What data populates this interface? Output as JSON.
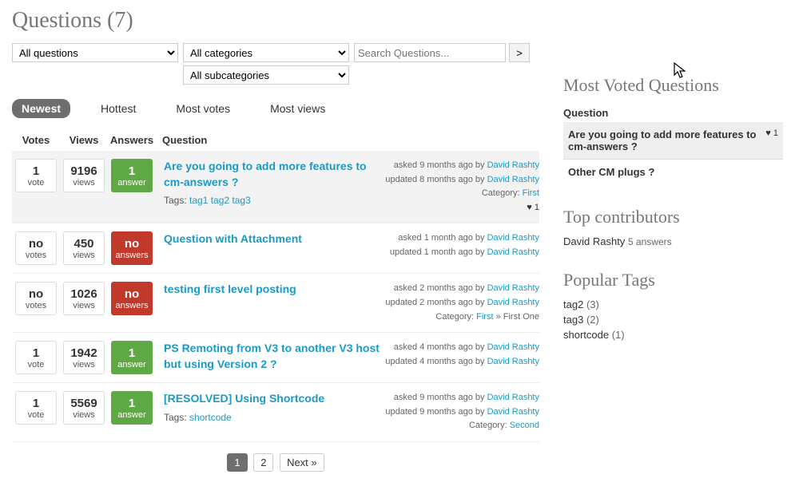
{
  "page": {
    "title": "Questions (7)"
  },
  "filters": {
    "questions_select": "All questions",
    "categories_select": "All categories",
    "subcategories_select": "All subcategories",
    "search_placeholder": "Search Questions...",
    "go_label": ">"
  },
  "sort_tabs": {
    "newest": "Newest",
    "hottest": "Hottest",
    "most_votes": "Most votes",
    "most_views": "Most views"
  },
  "list_headers": {
    "votes": "Votes",
    "views": "Views",
    "answers": "Answers",
    "question": "Question"
  },
  "labels": {
    "tags_prefix": "Tags:",
    "asked_prefix": "asked",
    "updated_prefix": "updated",
    "by": "by",
    "category_prefix": "Category:"
  },
  "questions": [
    {
      "votes_num": "1",
      "votes_label": "vote",
      "views_num": "9196",
      "views_label": "views",
      "answers_num": "1",
      "answers_label": "answer",
      "answers_color": "green",
      "title": "Are you going to add more features to cm-answers ?",
      "tags": [
        "tag1",
        "tag2",
        "tag3"
      ],
      "asked": "9 months ago",
      "asked_by": "David Rashty",
      "updated": "8 months ago",
      "updated_by": "David Rashty",
      "category": "First",
      "hearts": "♥ 1",
      "highlight": true
    },
    {
      "votes_num": "no",
      "votes_label": "votes",
      "views_num": "450",
      "views_label": "views",
      "answers_num": "no",
      "answers_label": "answers",
      "answers_color": "red",
      "title": "Question with Attachment",
      "tags": [],
      "asked": "1 month ago",
      "asked_by": "David Rashty",
      "updated": "1 month ago",
      "updated_by": "David Rashty"
    },
    {
      "votes_num": "no",
      "votes_label": "votes",
      "views_num": "1026",
      "views_label": "views",
      "answers_num": "no",
      "answers_label": "answers",
      "answers_color": "red",
      "title": "testing first level posting",
      "tags": [],
      "asked": "2 months ago",
      "asked_by": "David Rashty",
      "updated": "2 months ago",
      "updated_by": "David Rashty",
      "category": "First",
      "category_extra": " » First One"
    },
    {
      "votes_num": "1",
      "votes_label": "vote",
      "views_num": "1942",
      "views_label": "views",
      "answers_num": "1",
      "answers_label": "answer",
      "answers_color": "green",
      "title": "PS Remoting from V3 to another V3 host but using Version 2 ?",
      "tags": [],
      "asked": "4 months ago",
      "asked_by": "David Rashty",
      "updated": "4 months ago",
      "updated_by": "David Rashty"
    },
    {
      "votes_num": "1",
      "votes_label": "vote",
      "views_num": "5569",
      "views_label": "views",
      "answers_num": "1",
      "answers_label": "answer",
      "answers_color": "green",
      "title": "[RESOLVED] Using Shortcode",
      "tags": [
        "shortcode"
      ],
      "asked": "9 months ago",
      "asked_by": "David Rashty",
      "updated": "9 months ago",
      "updated_by": "David Rashty",
      "category": "Second"
    }
  ],
  "pager": {
    "page1": "1",
    "page2": "2",
    "next": "Next »"
  },
  "sidebar": {
    "most_voted_title": "Most Voted Questions",
    "mv_head": "Question",
    "mv_items": [
      {
        "text": "Are you going to add more features to cm-answers ?",
        "score": "♥ 1",
        "highlight": true
      },
      {
        "text": "Other CM plugs ?",
        "score": ""
      }
    ],
    "contrib_title": "Top contributors",
    "contributors": [
      {
        "name": "David Rashty",
        "count": "5 answers"
      }
    ],
    "tags_title": "Popular Tags",
    "tags": [
      {
        "name": "tag2",
        "count": "(3)"
      },
      {
        "name": "tag3",
        "count": "(2)"
      },
      {
        "name": "shortcode",
        "count": "(1)"
      }
    ]
  }
}
